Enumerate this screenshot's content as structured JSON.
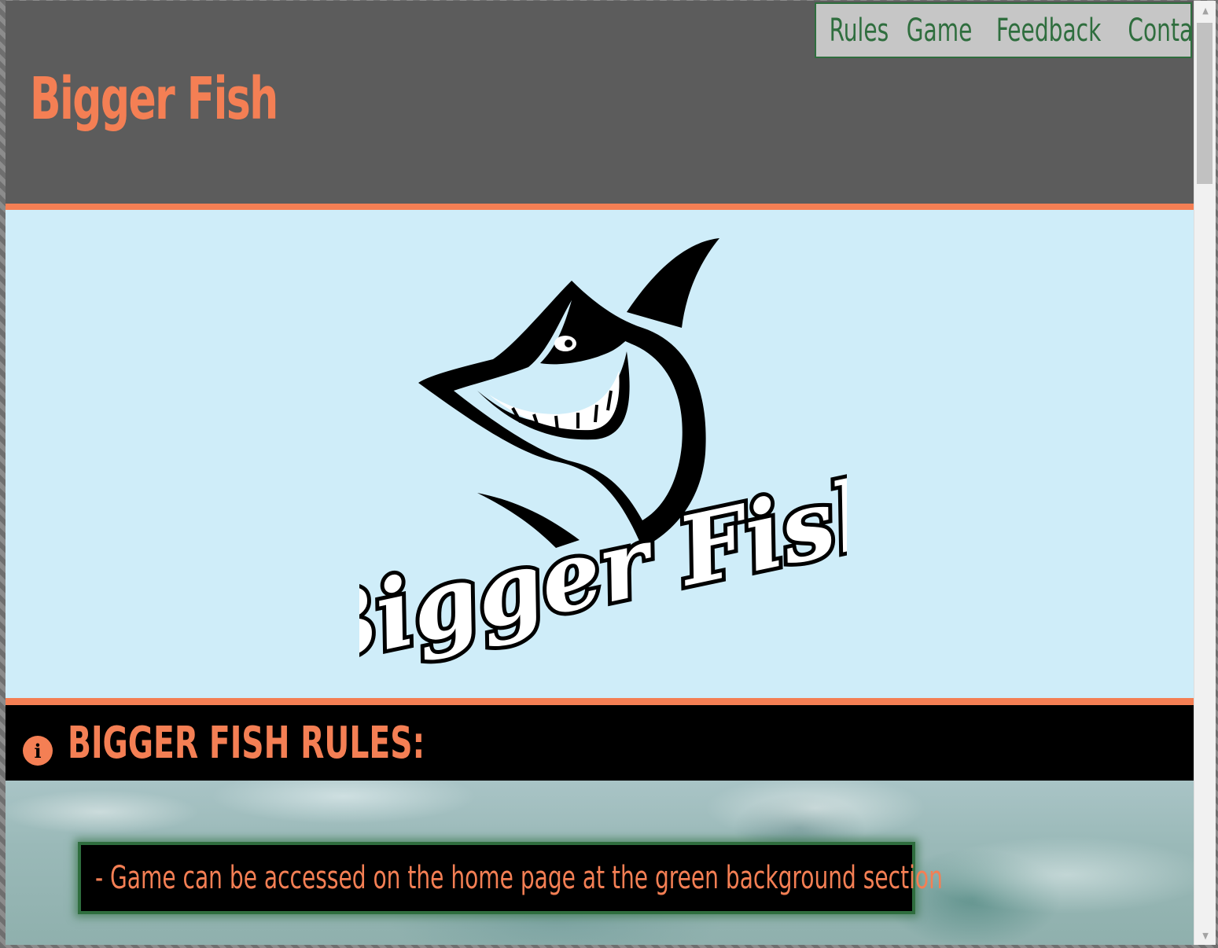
{
  "header": {
    "title": "Bigger Fish"
  },
  "nav": {
    "items": [
      {
        "label": "Rules"
      },
      {
        "label": "Game"
      },
      {
        "label": "Feedback"
      },
      {
        "label": "Contact"
      }
    ]
  },
  "hero": {
    "logo_text": "Bigger Fish",
    "logo_icon": "shark-logo"
  },
  "rules": {
    "icon": "info-icon",
    "title": "BIGGER FISH RULES:",
    "items": [
      "- Game can be accessed on the home page at the green background section"
    ]
  },
  "colors": {
    "accent": "#f47f54",
    "header_bg": "#5c5c5c",
    "hero_bg": "#cfedf9",
    "nav_text": "#2f6e3e",
    "nav_bg": "#c6c6c6"
  }
}
